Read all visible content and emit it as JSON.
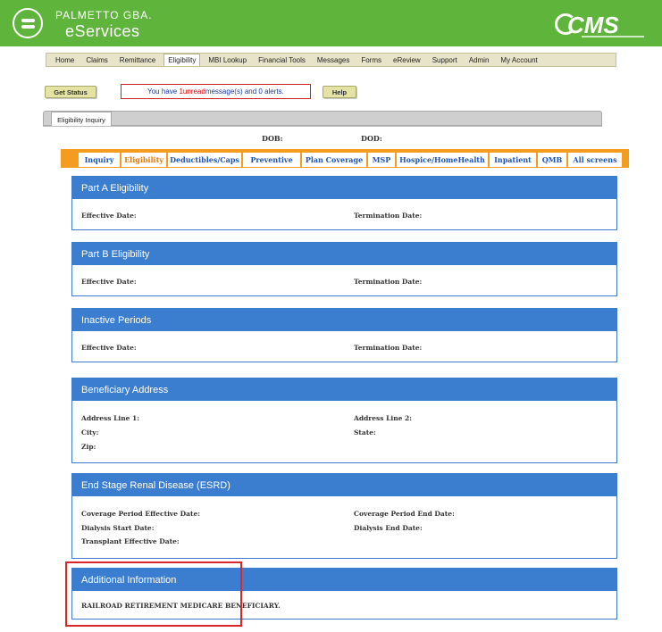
{
  "header": {
    "brand_top": "PALMETTO GBA.",
    "brand_main": "eServices",
    "partner_logo": "CMS"
  },
  "nav": {
    "items": [
      "Home",
      "Claims",
      "Remittance",
      "Eligibility",
      "MBI Lookup",
      "Financial Tools",
      "Messages",
      "Forms",
      "eReview",
      "Support",
      "Admin",
      "My Account"
    ],
    "active": "Eligibility"
  },
  "toolbar": {
    "get_status": "Get Status",
    "message_prefix": "You have ",
    "message_count": "1",
    "message_unread": " unread",
    "message_suffix": " message(s) and 0 alerts.",
    "help": "Help"
  },
  "page_tab": "Eligibility Inquiry",
  "patient": {
    "dob_label": "DOB:",
    "dod_label": "DOD:"
  },
  "subnav": {
    "tabs": [
      "Inquiry",
      "Eligibility",
      "Deductibles/Caps",
      "Preventive",
      "Plan Coverage",
      "MSP",
      "Hospice/HomeHealth",
      "Inpatient",
      "QMB",
      "All screens"
    ],
    "active": "Eligibility"
  },
  "panels": {
    "part_a": {
      "title": "Part A Eligibility",
      "effective": "Effective Date:",
      "termination": "Termination Date:"
    },
    "part_b": {
      "title": "Part B Eligibility",
      "effective": "Effective Date:",
      "termination": "Termination Date:"
    },
    "inactive": {
      "title": "Inactive Periods",
      "effective": "Effective Date:",
      "termination": "Termination Date:"
    },
    "address": {
      "title": "Beneficiary Address",
      "line1": "Address Line 1:",
      "line2": "Address Line 2:",
      "city": "City:",
      "state": "State:",
      "zip": "Zip:"
    },
    "esrd": {
      "title": "End Stage Renal Disease (ESRD)",
      "cov_eff": "Coverage Period Effective Date:",
      "cov_end": "Coverage Period End Date:",
      "dialysis_start": "Dialysis Start Date:",
      "dialysis_end": "Dialysis End Date:",
      "transplant": "Transplant Effective Date:"
    },
    "additional": {
      "title": "Additional Information",
      "text": "RAILROAD RETIREMENT MEDICARE BENEFICIARY."
    }
  },
  "colors": {
    "header_green": "#5fb53c",
    "panel_blue": "#3b7dcf",
    "subnav_orange": "#f39c1f",
    "highlight_red": "#d9262b"
  }
}
